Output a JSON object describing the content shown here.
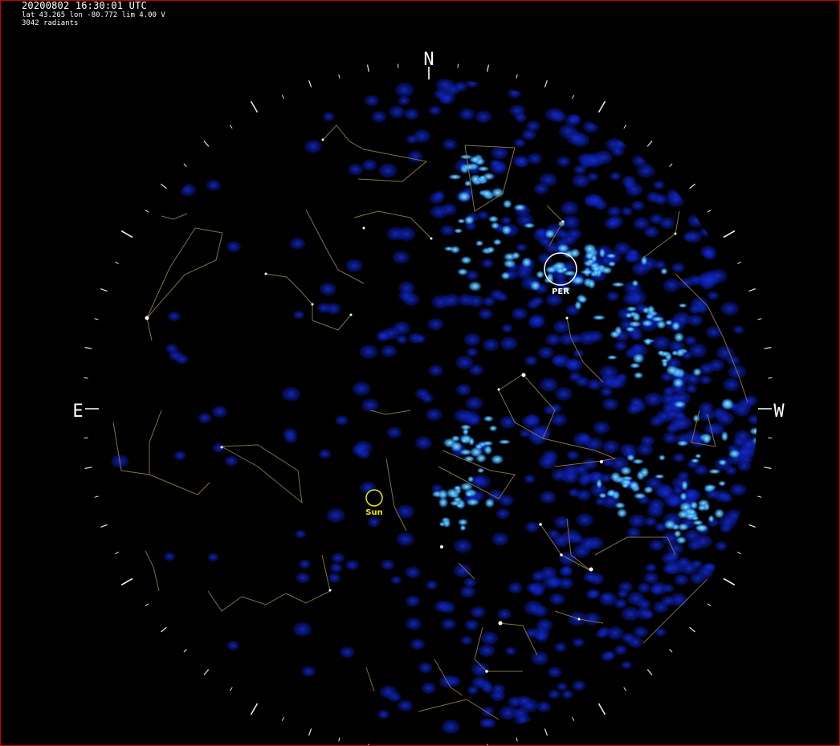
{
  "header": {
    "timestamp": "20200802 16:30:01 UTC",
    "location": "lat 43.265 lon -80.772 lim 4.00 V",
    "radiants": "3042 radiants"
  },
  "compass": {
    "north": "N",
    "east": "E",
    "west": "W"
  },
  "markers": {
    "shower_label": "PER",
    "sun_label": "Sun"
  },
  "colors": {
    "background": "#000000",
    "frame_border": "#cc0000",
    "radiant_dark": "#0a1aa8",
    "radiant_bright": "#4fd4ff",
    "constellation_lines": "#807048",
    "sun": "#e8e800",
    "text": "#ffffff"
  }
}
